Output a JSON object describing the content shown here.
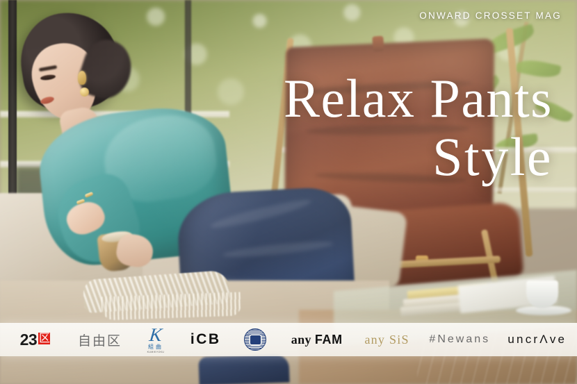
{
  "banner": {
    "eyebrow": "ONWARD CROSSET MAG",
    "headline_line1": "Relax Pants",
    "headline_line2": "Style",
    "colors": {
      "headline_text": "#ffffff",
      "eyebrow_text": "#ffffff",
      "logo_bar_background": "#fbfaf7",
      "accent_red": "#e2231a",
      "accent_blue": "#24407a",
      "accent_gold": "#b29b62",
      "top_teal": "#2e8f8c",
      "pants_navy": "#1a2a4b",
      "leather_brown": "#7d3a26",
      "sofa_beige": "#cfc3ae"
    }
  },
  "brand_bar": {
    "logos": [
      {
        "name": "23ku",
        "text_main": "23",
        "text_mark": "区",
        "mark_color": "#e2231a"
      },
      {
        "name": "jiyuku",
        "text": "自由区"
      },
      {
        "name": "kumikyoku",
        "mark": "K",
        "kanji": "組曲",
        "romaji": "KUMIKYOKU"
      },
      {
        "name": "icb",
        "text_lower": "i",
        "text_upper": "CB"
      },
      {
        "name": "seal",
        "text": ""
      },
      {
        "name": "any-fam",
        "text_any": "any",
        "text_fam": "FAM"
      },
      {
        "name": "any-sis",
        "text_any": "any",
        "text_sis": "SiS"
      },
      {
        "name": "newans",
        "text": "#Newans"
      },
      {
        "name": "uncrave",
        "text_pre": "uncr",
        "text_a": "Λ",
        "text_post": "ve"
      }
    ]
  }
}
